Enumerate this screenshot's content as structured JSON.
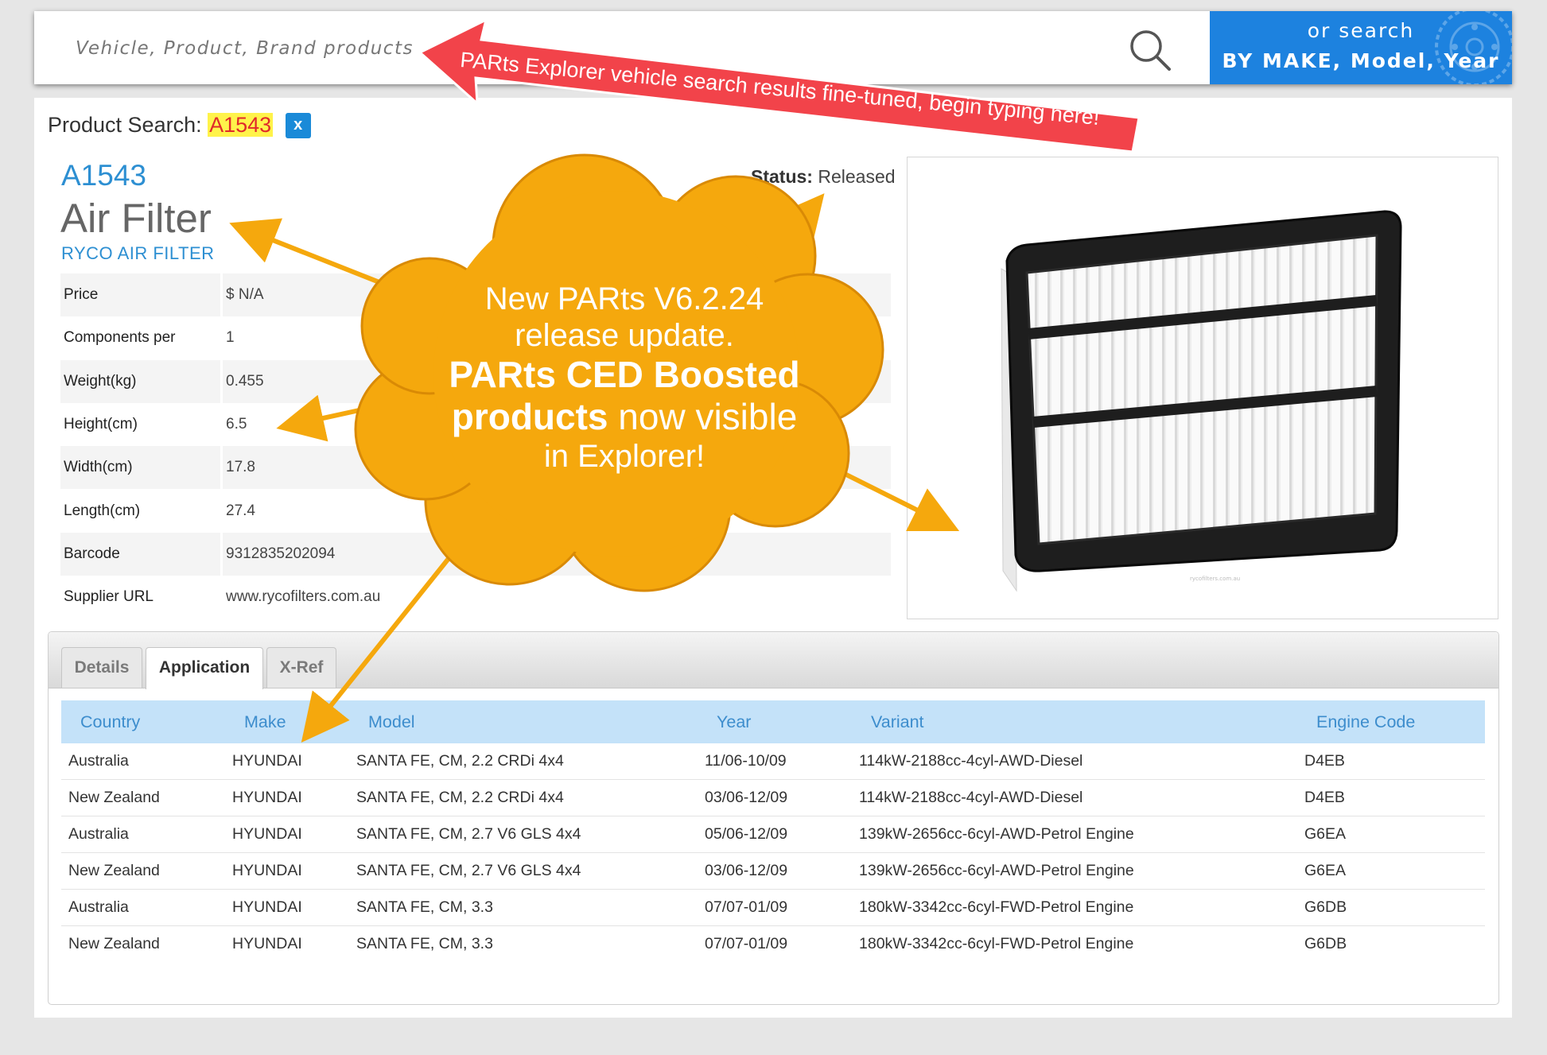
{
  "search": {
    "placeholder": "Vehicle, Product, Brand products",
    "make_button_line1": "or search",
    "make_button_line2": "BY MAKE, Model, Year"
  },
  "product_search": {
    "label": "Product Search:",
    "term": "A1543",
    "clear_label": "x"
  },
  "product": {
    "part_number": "A1543",
    "title": "Air Filter",
    "brand": "RYCO AIR FILTER",
    "status_label": "Status:",
    "status_value": "Released",
    "specs": [
      {
        "key": "Price",
        "value": "$ N/A"
      },
      {
        "key": "Components per",
        "value": "1"
      },
      {
        "key": "Weight(kg)",
        "value": "0.455"
      },
      {
        "key": "Height(cm)",
        "value": "6.5"
      },
      {
        "key": "Width(cm)",
        "value": "17.8"
      },
      {
        "key": "Length(cm)",
        "value": "27.4"
      },
      {
        "key": "Barcode",
        "value": "9312835202094"
      },
      {
        "key": "Supplier URL",
        "value": "www.rycofilters.com.au"
      }
    ],
    "image_caption": "rycofilters.com.au"
  },
  "tabs": [
    {
      "label": "Details",
      "active": false
    },
    {
      "label": "Application",
      "active": true
    },
    {
      "label": "X-Ref",
      "active": false
    }
  ],
  "application_table": {
    "headers": [
      "Country",
      "Make",
      "Model",
      "Year",
      "Variant",
      "Engine Code"
    ],
    "rows": [
      [
        "Australia",
        "HYUNDAI",
        "SANTA FE, CM, 2.2 CRDi 4x4",
        "11/06-10/09",
        "114kW-2188cc-4cyl-AWD-Diesel",
        "D4EB"
      ],
      [
        "New Zealand",
        "HYUNDAI",
        "SANTA FE, CM, 2.2 CRDi 4x4",
        "03/06-12/09",
        "114kW-2188cc-4cyl-AWD-Diesel",
        "D4EB"
      ],
      [
        "Australia",
        "HYUNDAI",
        "SANTA FE, CM, 2.7 V6 GLS 4x4",
        "05/06-12/09",
        "139kW-2656cc-6cyl-AWD-Petrol Engine",
        "G6EA"
      ],
      [
        "New Zealand",
        "HYUNDAI",
        "SANTA FE, CM, 2.7 V6 GLS 4x4",
        "03/06-12/09",
        "139kW-2656cc-6cyl-AWD-Petrol Engine",
        "G6EA"
      ],
      [
        "Australia",
        "HYUNDAI",
        "SANTA FE, CM, 3.3",
        "07/07-01/09",
        "180kW-3342cc-6cyl-FWD-Petrol Engine",
        "G6DB"
      ],
      [
        "New Zealand",
        "HYUNDAI",
        "SANTA FE, CM, 3.3",
        "07/07-01/09",
        "180kW-3342cc-6cyl-FWD-Petrol Engine",
        "G6DB"
      ]
    ]
  },
  "annotations": {
    "banner": "PARts Explorer vehicle search results fine-tuned, begin typing here!",
    "cloud_line1": "New PARts V6.2.24",
    "cloud_line2": "release update.",
    "cloud_bold1": "PARts CED Boosted",
    "cloud_bold2": "products",
    "cloud_after_bold": " now visible",
    "cloud_line5": "in Explorer!"
  },
  "colors": {
    "accent_blue": "#1d82df",
    "cloud_orange": "#f5a80d",
    "banner_red": "#f2434a",
    "highlight_yellow": "#fff34a"
  }
}
